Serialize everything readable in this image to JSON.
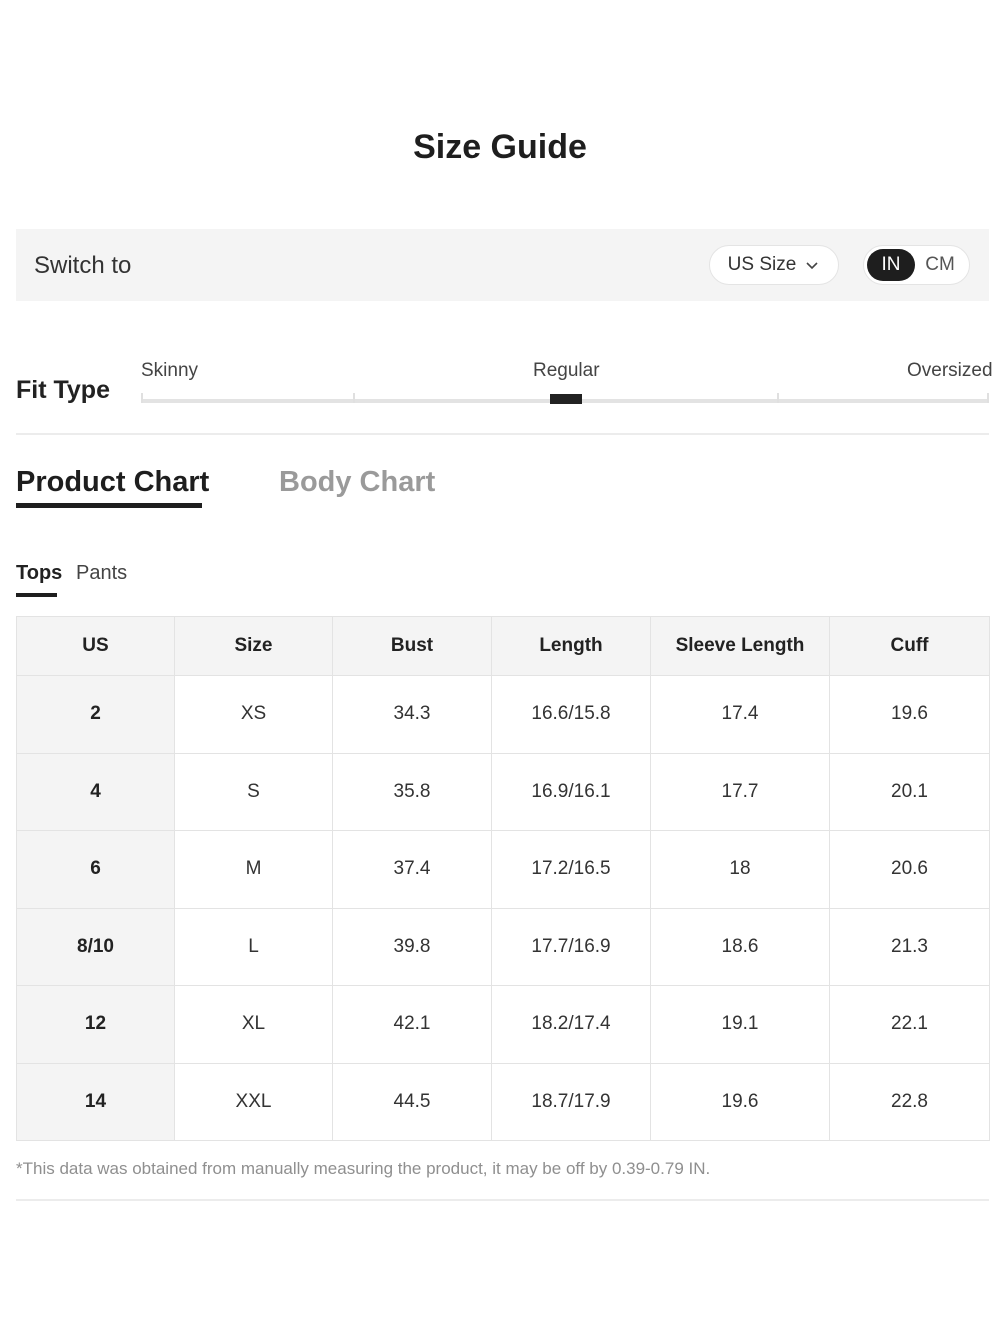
{
  "page": {
    "title": "Size Guide"
  },
  "switch_bar": {
    "label": "Switch to",
    "size_select": "US Size",
    "units": {
      "active": "IN",
      "inactive": "CM"
    }
  },
  "fit_type": {
    "title": "Fit Type",
    "labels": [
      "Skinny",
      "Regular",
      "Oversized"
    ],
    "selected": "Regular"
  },
  "chart_tabs": {
    "active": "Product Chart",
    "inactive": "Body Chart"
  },
  "sub_tabs": {
    "active": "Tops",
    "inactive": "Pants"
  },
  "table": {
    "headers": [
      "US",
      "Size",
      "Bust",
      "Length",
      "Sleeve Length",
      "Cuff"
    ],
    "rows": [
      [
        "2",
        "XS",
        "34.3",
        "16.6/15.8",
        "17.4",
        "19.6"
      ],
      [
        "4",
        "S",
        "35.8",
        "16.9/16.1",
        "17.7",
        "20.1"
      ],
      [
        "6",
        "M",
        "37.4",
        "17.2/16.5",
        "18",
        "20.6"
      ],
      [
        "8/10",
        "L",
        "39.8",
        "17.7/16.9",
        "18.6",
        "21.3"
      ],
      [
        "12",
        "XL",
        "42.1",
        "18.2/17.4",
        "19.1",
        "22.1"
      ],
      [
        "14",
        "XXL",
        "44.5",
        "18.7/17.9",
        "19.6",
        "22.8"
      ]
    ]
  },
  "note": "*This data was obtained from manually measuring the product, it may be off by 0.39-0.79 IN."
}
